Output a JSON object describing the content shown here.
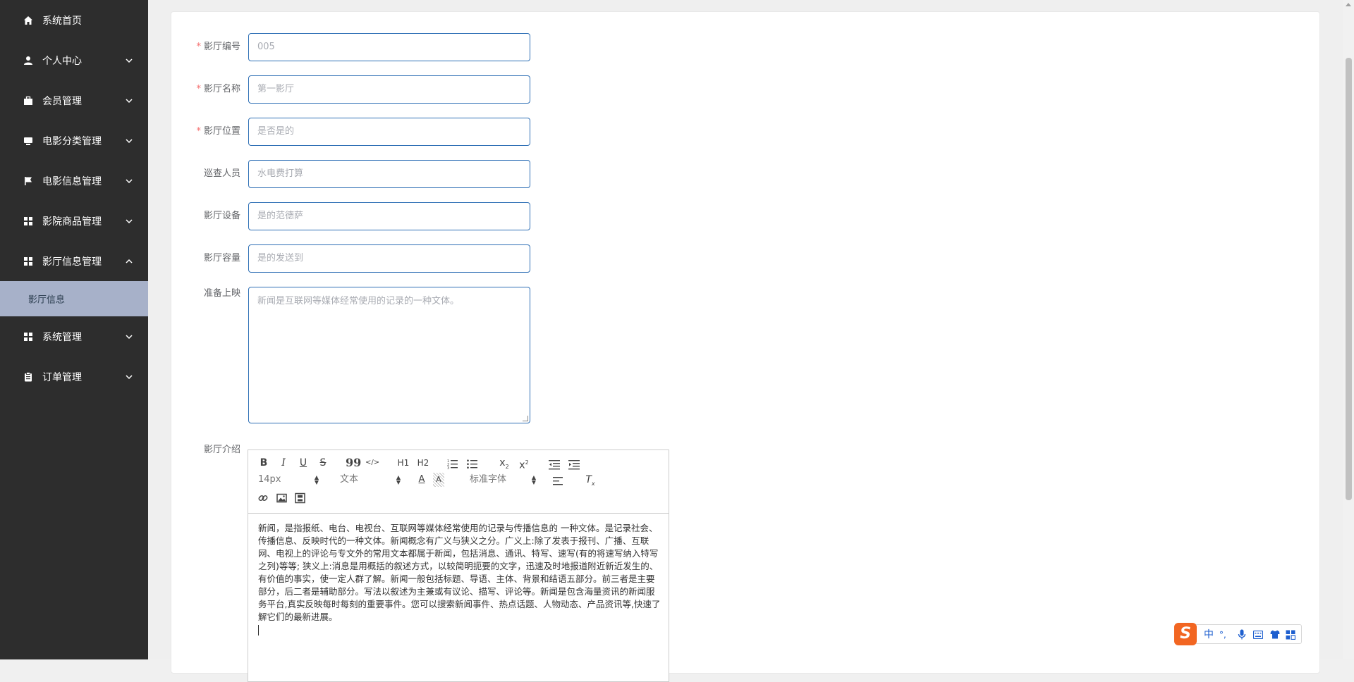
{
  "sidebar": {
    "items": [
      {
        "label": "系统首页",
        "icon": "home-icon",
        "chevron": "none"
      },
      {
        "label": "个人中心",
        "icon": "user-icon",
        "chevron": "down"
      },
      {
        "label": "会员管理",
        "icon": "briefcase-icon",
        "chevron": "down"
      },
      {
        "label": "电影分类管理",
        "icon": "monitor-icon",
        "chevron": "down"
      },
      {
        "label": "电影信息管理",
        "icon": "flag-icon",
        "chevron": "down"
      },
      {
        "label": "影院商品管理",
        "icon": "grid-icon",
        "chevron": "down"
      },
      {
        "label": "影厅信息管理",
        "icon": "grid-icon",
        "chevron": "up"
      },
      {
        "label": "系统管理",
        "icon": "grid-icon",
        "chevron": "down"
      },
      {
        "label": "订单管理",
        "icon": "clipboard-icon",
        "chevron": "down"
      }
    ],
    "active_sub": "影厅信息"
  },
  "form": {
    "hall_no": {
      "label": "影厅编号",
      "required": true,
      "value": "005"
    },
    "hall_name": {
      "label": "影厅名称",
      "required": true,
      "value": "第一影厅"
    },
    "hall_location": {
      "label": "影厅位置",
      "required": true,
      "value": "是否是的"
    },
    "inspector": {
      "label": "巡查人员",
      "required": false,
      "value": "水电费打算"
    },
    "equipment": {
      "label": "影厅设备",
      "required": false,
      "value": "是的范德萨"
    },
    "capacity": {
      "label": "影厅容量",
      "required": false,
      "value": "是的发送到"
    },
    "screening": {
      "label": "准备上映",
      "required": false,
      "value": "新闻是互联网等媒体经常使用的记录的一种文体。"
    },
    "intro": {
      "label": "影厅介绍"
    }
  },
  "editor": {
    "font_size": "14px",
    "block_format": "文本",
    "font_family": "标准字体",
    "content": "新闻，是指报纸、电台、电视台、互联网等媒体经常使用的记录与传播信息的 一种文体。是记录社会、传播信息、反映时代的一种文体。新闻概念有广义与狭义之分。广义上:除了发表于报刊、广播、互联网、电视上的评论与专文外的常用文本都属于新闻，包括消息、通讯、特写、速写(有的将速写纳入特写之列)等等; 狭义上:消息是用概括的叙述方式，以较简明扼要的文字，迅速及时地报道附近新近发生的、有价值的事实，使一定人群了解。新闻一般包括标题、导语、主体、背景和结语五部分。前三者是主要部分，后二者是辅助部分。写法以叙述为主兼或有议论、描写、评论等。新闻是包含海量资讯的新闻服务平台,真实反映每时每刻的重要事件。您可以搜索新闻事件、热点话题、人物动态、产品资讯等,快速了解它们的最新进展。",
    "toolbar": {
      "bold": "B",
      "italic": "I",
      "underline": "U",
      "strike": "S",
      "quote": "99",
      "code": "</>",
      "h1": "H1",
      "h2": "H2",
      "sub": "x2",
      "sup": "x2"
    }
  },
  "ime": {
    "logo": "S",
    "mode": "中",
    "punct": "°,",
    "items": [
      "mic-icon",
      "keyboard-icon",
      "shirt-icon",
      "apps-icon"
    ]
  },
  "colors": {
    "sidebar_bg": "#2d2d2d",
    "active_sub_bg": "#a7b1c9",
    "input_border": "#2e6fb5",
    "required": "#f56c6c",
    "ime_logo": "#f26622"
  }
}
